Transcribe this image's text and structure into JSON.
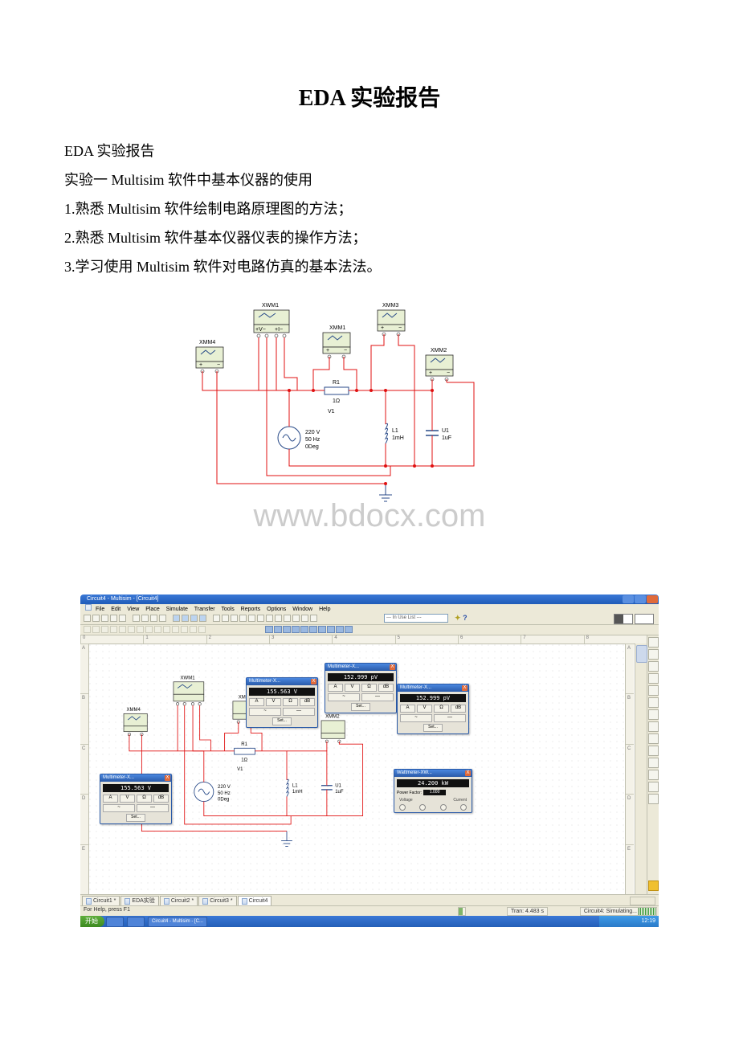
{
  "doc": {
    "title": "EDA 实验报告",
    "lines": [
      "EDA 实验报告",
      "实验一 Multisim 软件中基本仪器的使用",
      "1.熟悉 Multisim 软件绘制电路原理图的方法；",
      "2.熟悉 Multisim 软件基本仪器仪表的操作方法；",
      "3.学习使用 Multisim 软件对电路仿真的基本法法。"
    ],
    "watermark": "www.bdocx.com"
  },
  "circuit": {
    "instruments": {
      "xwm1": "XWM1",
      "xmm1": "XMM1",
      "xmm2": "XMM2",
      "xmm3": "XMM3",
      "xmm4": "XMM4"
    },
    "components": {
      "r1": {
        "ref": "R1",
        "val": "1Ω"
      },
      "v1": {
        "ref": "V1",
        "lines": [
          "220 V",
          "50 Hz",
          "0Deg"
        ]
      },
      "l1": {
        "ref": "L1",
        "val": "1mH"
      },
      "u1": {
        "ref": "U1",
        "val": "1uF"
      }
    }
  },
  "screenshot": {
    "window_title": "Circuit4 - Multisim - [Circuit4]",
    "menus": [
      "File",
      "Edit",
      "View",
      "Place",
      "Simulate",
      "Transfer",
      "Tools",
      "Reports",
      "Options",
      "Window",
      "Help"
    ],
    "inuse_dropdown": "--- In Use List ---",
    "help_icon": "?",
    "ruler_cols": [
      "0",
      "1",
      "2",
      "3",
      "4",
      "5",
      "6",
      "7",
      "8"
    ],
    "ruler_rows": [
      "A",
      "B",
      "C",
      "D",
      "E"
    ],
    "tabs": [
      "Circuit1 *",
      "EDA实验",
      "Circuit2 *",
      "Circuit3 *",
      "Circuit4"
    ],
    "status_left": "For Help, press F1",
    "status_tran": "Tran: 4.483 s",
    "status_right": "Circuit4: Simulating...",
    "start_label": "开始",
    "task_buttons": [
      "",
      "",
      "Circuit4 - Multisim - [C..."
    ],
    "clock": "12:19",
    "dialogs": {
      "multimeter_title": "Multimeter-X...",
      "wattmeter_title": "Wattmeter-XW...",
      "mm_close": "X",
      "xmm4_reading": "155.563 V",
      "xmm1_reading": "155.563 V",
      "xmm3_reading": "152.999 pV",
      "xmm2_reading": "152.999 pV",
      "xwm1_reading": "24.200 kW",
      "power_factor_label": "Power Factor:",
      "power_factor_value": "1.000",
      "voltage_label": "Voltage",
      "current_label": "Current",
      "mm_buttons": [
        "A",
        "V",
        "Ω",
        "dB"
      ],
      "mm_mode_ac": "~",
      "mm_mode_dc": "—",
      "mm_set": "Set..."
    }
  }
}
